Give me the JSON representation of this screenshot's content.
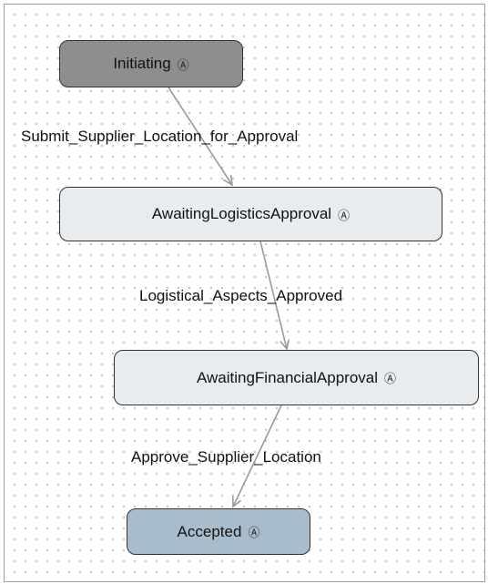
{
  "states": [
    {
      "id": "initiating",
      "label": "Initiating",
      "icon": "state-marker-icon",
      "glyph": "Ⓐ",
      "kind": "initial",
      "color": "#8e8e8e"
    },
    {
      "id": "awaiting-logistics",
      "label": "AwaitingLogisticsApproval",
      "icon": "state-marker-icon",
      "glyph": "Ⓐ",
      "kind": "intermediate",
      "color": "#e8ecef"
    },
    {
      "id": "awaiting-financial",
      "label": "AwaitingFinancialApproval",
      "icon": "state-marker-icon",
      "glyph": "Ⓐ",
      "kind": "intermediate",
      "color": "#e8ecef"
    },
    {
      "id": "accepted",
      "label": "Accepted",
      "icon": "state-marker-icon",
      "glyph": "Ⓐ",
      "kind": "final",
      "color": "#a9bccb"
    }
  ],
  "transitions": [
    {
      "from": "initiating",
      "to": "awaiting-logistics",
      "label": "Submit_Supplier_Location_for_Approval"
    },
    {
      "from": "awaiting-logistics",
      "to": "awaiting-financial",
      "label": "Logistical_Aspects_Approved"
    },
    {
      "from": "awaiting-financial",
      "to": "accepted",
      "label": "Approve_Supplier_Location"
    }
  ],
  "colors": {
    "edge": "#9a9a9a",
    "border": "#333333",
    "grid_dot": "#b8b8b8"
  }
}
